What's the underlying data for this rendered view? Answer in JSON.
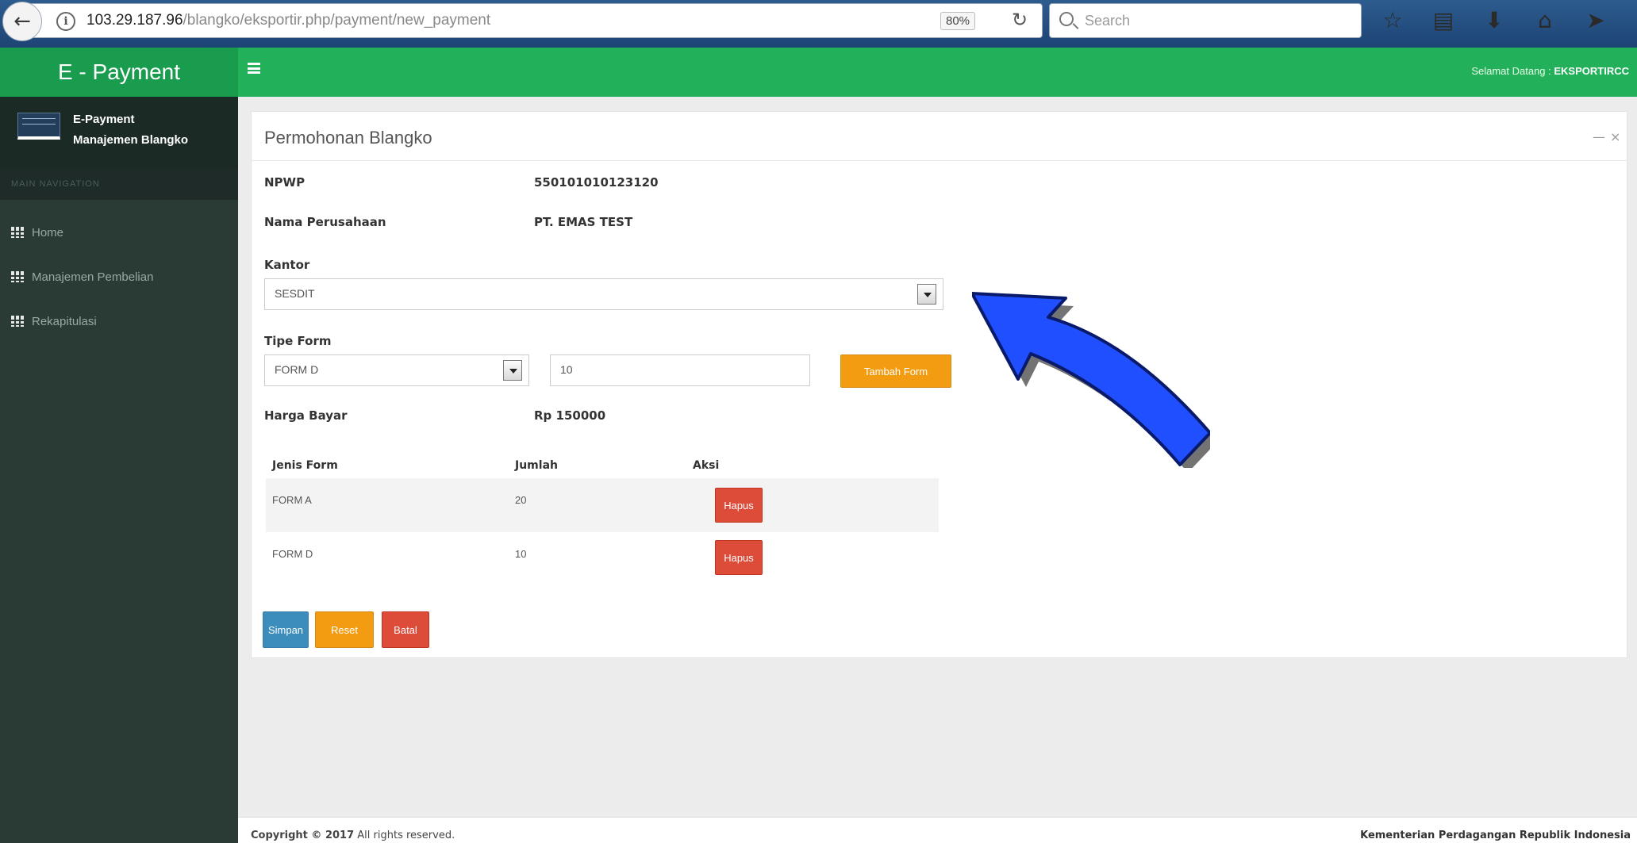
{
  "browser": {
    "url_host": "103.29.187.96",
    "url_path": "/blangko/eksportir.php/payment/new_payment",
    "zoom": "80%",
    "search_placeholder": "Search"
  },
  "app": {
    "brand": "E - Payment",
    "welcome_prefix": "Selamat Datang : ",
    "welcome_user": "EKSPORTIRCC"
  },
  "sidebar": {
    "profile_name": "E-Payment",
    "profile_role": "Manajemen Blangko",
    "nav_label": "MAIN NAVIGATION",
    "items": [
      {
        "label": "Home"
      },
      {
        "label": "Manajemen Pembelian"
      },
      {
        "label": "Rekapitulasi"
      }
    ]
  },
  "panel": {
    "title": "Permohonan Blangko",
    "npwp_label": "NPWP",
    "npwp_value": "550101010123120",
    "company_label": "Nama Perusahaan",
    "company_value": "PT. EMAS TEST",
    "kantor_label": "Kantor",
    "kantor_value": "SESDIT",
    "tipe_label": "Tipe Form",
    "tipe_value": "FORM D",
    "jumlah_value": "10",
    "tambah_label": "Tambah Form",
    "harga_label": "Harga Bayar",
    "harga_value": "Rp 150000",
    "table": {
      "headers": [
        "Jenis Form",
        "Jumlah",
        "Aksi"
      ],
      "rows": [
        {
          "jenis": "FORM A",
          "jumlah": "20",
          "aksi": "Hapus"
        },
        {
          "jenis": "FORM D",
          "jumlah": "10",
          "aksi": "Hapus"
        }
      ]
    },
    "buttons": {
      "simpan": "Simpan",
      "reset": "Reset",
      "batal": "Batal"
    }
  },
  "footer": {
    "copyright_bold": "Copyright © 2017",
    "copyright_rest": " All rights reserved.",
    "ministry": "Kementerian Perdagangan Republik Indonesia"
  },
  "colors": {
    "brand_green": "#1a9c4e",
    "topbar_green": "#22b15a",
    "sidebar_bg": "#2a3b35",
    "annotation_arrow": "#1f4fff"
  },
  "icons": [
    "back-arrow-icon",
    "info-icon",
    "reload-icon",
    "search-icon",
    "star-icon",
    "bookmarks-icon",
    "download-icon",
    "home-icon",
    "send-icon",
    "menu-icon",
    "hamburger-icon",
    "grid-icon",
    "minimize-icon",
    "close-icon"
  ]
}
